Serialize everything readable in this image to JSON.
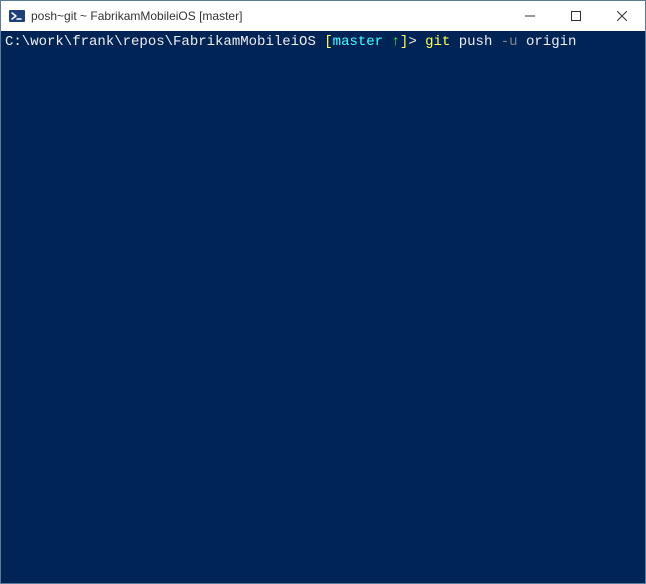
{
  "window": {
    "title": "posh~git ~ FabrikamMobileiOS [master]"
  },
  "prompt": {
    "path": "C:\\work\\frank\\repos\\FabrikamMobileiOS",
    "bracket_open": " [",
    "branch": "master",
    "arrow": " ↑",
    "bracket_close": "]",
    "prompt_char": ">"
  },
  "command": {
    "git": "git",
    "sub": "push",
    "flag": "-u",
    "arg": "origin"
  }
}
